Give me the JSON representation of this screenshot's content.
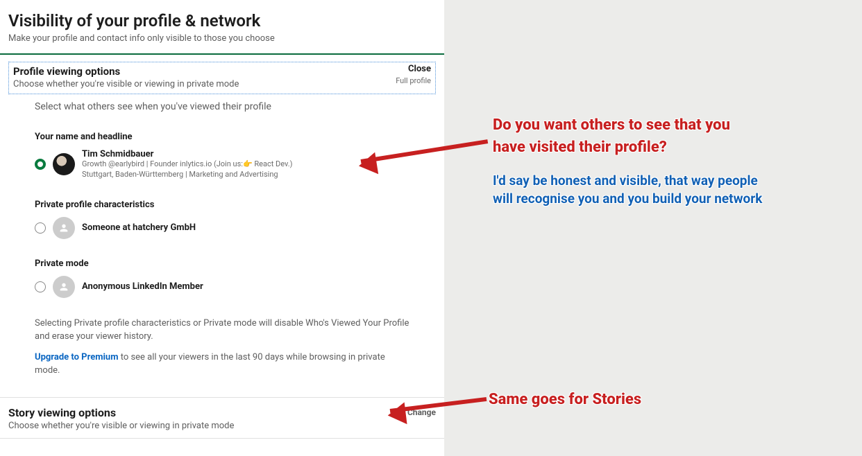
{
  "header": {
    "title": "Visibility of your profile & network",
    "subtitle": "Make your profile and contact info only visible to those you choose"
  },
  "profile_viewing": {
    "title": "Profile viewing options",
    "subtitle": "Choose whether you're visible or viewing in private mode",
    "close": "Close",
    "mode": "Full profile",
    "instruction": "Select what others see when you've viewed their profile",
    "options": {
      "full": {
        "label": "Your name and headline",
        "name": "Tim Schmidbauer",
        "line1": "Growth @earlybird | Founder inlytics.io (Join us:👉 React Dev.)",
        "line2": "Stuttgart, Baden-Württemberg | Marketing and Advertising"
      },
      "semi": {
        "label": "Private profile characteristics",
        "text": "Someone at hatchery GmbH"
      },
      "private": {
        "label": "Private mode",
        "text": "Anonymous LinkedIn Member"
      }
    },
    "disclaimer": "Selecting Private profile characteristics or Private mode will disable Who's Viewed Your Profile and erase your viewer history.",
    "upgrade_link": "Upgrade to Premium",
    "upgrade_rest": " to see all your viewers in the last 90 days while browsing in private mode."
  },
  "story_viewing": {
    "title": "Story viewing options",
    "subtitle": "Choose whether you're visible or viewing in private mode",
    "change": "Change"
  },
  "annotations": {
    "q1a": "Do you want others to see that you",
    "q1b": "have visited their profile?",
    "a1a": "I'd say be honest and visible, that way people",
    "a1b": "will recognise you and you build your network",
    "q2": "Same goes for Stories"
  }
}
